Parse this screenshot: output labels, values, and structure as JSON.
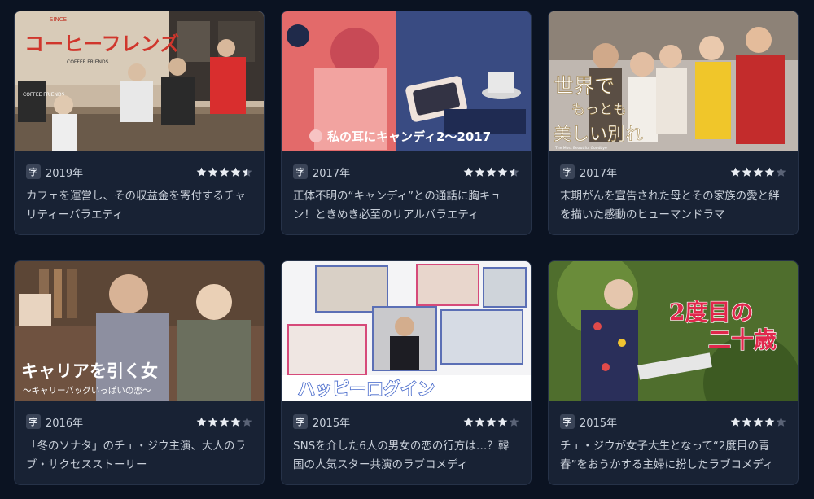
{
  "subtitle_badge": "字",
  "cards": [
    {
      "title": "コーヒーフレンズ",
      "title_en": "COFFEE FRIENDS",
      "since": "SINCE",
      "year": "2019年",
      "rating": 4.5,
      "description": "カフェを運営し、その収益金を寄付するチャリティーバラエティ",
      "sign": "COFFEE FRIENDS"
    },
    {
      "title": "私の耳にキャンディ2～2017",
      "year": "2017年",
      "rating": 4.5,
      "description": "正体不明の“キャンディ”との通話に胸キュン！ときめき必至のリアルバラエティ"
    },
    {
      "title_line1": "世界で",
      "title_line2": "もっとも",
      "title_line3": "美しい別れ",
      "title_en": "The Most Beautiful Goodbye",
      "year": "2017年",
      "rating": 4,
      "description": "末期がんを宣告された母とその家族の愛と絆を描いた感動のヒューマンドラマ"
    },
    {
      "title": "キャリアを引く女",
      "subtitle": "～キャリーバッグいっぱいの恋～",
      "year": "2016年",
      "rating": 4,
      "description": "「冬のソナタ」のチェ・ジウ主演、大人のラブ・サクセスストーリー"
    },
    {
      "title": "ハッピーログイン",
      "year": "2015年",
      "rating": 4,
      "description": "SNSを介した6人の男女の恋の行方は…？韓国の人気スター共演のラブコメディ"
    },
    {
      "title_line1": "2度目の",
      "title_line2": "二十歳",
      "year": "2015年",
      "rating": 4,
      "description": "チェ・ジウが女子大生となって“2度目の青春”をおうかする主婦に扮したラブコメディ"
    }
  ],
  "colors": {
    "star_on": "#e9edf3",
    "star_off": "#5a6376",
    "card_bg": "#182234",
    "page_bg": "#0b1322"
  }
}
